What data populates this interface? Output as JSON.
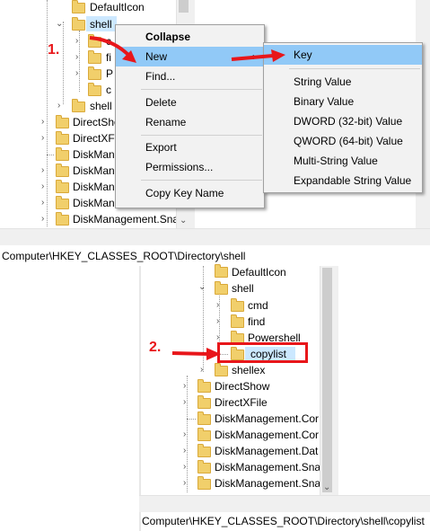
{
  "top_panel": {
    "tree": [
      {
        "label": "DefaultIcon"
      },
      {
        "label": "shell"
      },
      {
        "label": "c"
      },
      {
        "label": "fi"
      },
      {
        "label": "P"
      },
      {
        "label": "c"
      },
      {
        "label": "shell"
      },
      {
        "label": "DirectSho"
      },
      {
        "label": "DirectXFi"
      },
      {
        "label": "DiskMana"
      },
      {
        "label": "DiskMana"
      },
      {
        "label": "DiskMana"
      },
      {
        "label": "DiskMana"
      },
      {
        "label": "DiskManagement.Sna"
      }
    ],
    "status_path": "Computer\\HKEY_CLASSES_ROOT\\Directory\\shell"
  },
  "context_menu": {
    "items": [
      {
        "label": "Collapse",
        "bold": true
      },
      {
        "label": "New",
        "highlighted": true
      },
      {
        "label": "Find..."
      },
      {
        "label": "Delete"
      },
      {
        "label": "Rename"
      },
      {
        "label": "Export"
      },
      {
        "label": "Permissions..."
      },
      {
        "label": "Copy Key Name"
      }
    ],
    "submenu_arrow": "›"
  },
  "submenu": {
    "items": [
      {
        "label": "Key",
        "highlighted": true
      },
      {
        "label": "String Value"
      },
      {
        "label": "Binary Value"
      },
      {
        "label": "DWORD (32-bit) Value"
      },
      {
        "label": "QWORD (64-bit) Value"
      },
      {
        "label": "Multi-String Value"
      },
      {
        "label": "Expandable String Value"
      }
    ]
  },
  "bottom_panel": {
    "tree": [
      {
        "label": "DefaultIcon"
      },
      {
        "label": "shell"
      },
      {
        "label": "cmd"
      },
      {
        "label": "find"
      },
      {
        "label": "Powershell"
      },
      {
        "label": "copylist"
      },
      {
        "label": "shellex"
      },
      {
        "label": "DirectShow"
      },
      {
        "label": "DirectXFile"
      },
      {
        "label": "DiskManagement.Cor"
      },
      {
        "label": "DiskManagement.Cor"
      },
      {
        "label": "DiskManagement.Dat"
      },
      {
        "label": "DiskManagement.Sna"
      },
      {
        "label": "DiskManagement.Sna"
      }
    ],
    "status_path": "Computer\\HKEY_CLASSES_ROOT\\Directory\\shell\\copylist"
  },
  "annotations": {
    "step1": "1.",
    "step2": "2."
  },
  "colors": {
    "highlight": "#91c9f7",
    "arrow_red": "#e8161a",
    "folder": "#f1cf6b"
  }
}
